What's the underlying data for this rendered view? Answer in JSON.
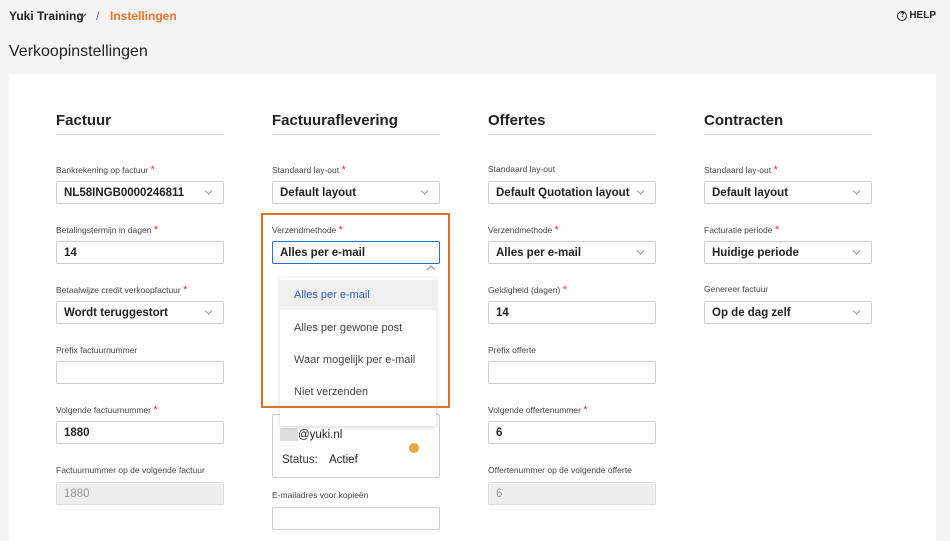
{
  "breadcrumb": {
    "app": "Yuki Training",
    "separator": "/",
    "current": "Instellingen"
  },
  "help_label": "HELP",
  "page_title": "Verkoopinstellingen",
  "required_mark": "*",
  "colors": {
    "accent": "#e8742a",
    "required": "#e53030",
    "status_dot": "#e8a640",
    "selected_text": "#2a5db0"
  },
  "factuur": {
    "title": "Factuur",
    "bankrekening": {
      "label": "Bankrekening op factuur",
      "value": "NL58INGB0000246811"
    },
    "betalingstermijn": {
      "label": "Betalingstermijn in dagen",
      "value": "14"
    },
    "betaalwijze": {
      "label": "Betaalwijze credit verkoopfactuur",
      "value": "Wordt teruggestort"
    },
    "prefix": {
      "label": "Prefix factuurnummer",
      "value": ""
    },
    "volgende": {
      "label": "Volgende factuurnummer",
      "value": "1880"
    },
    "opvolgende": {
      "label": "Factuurnummer op de volgende factuur",
      "value": "1880"
    }
  },
  "factuuraflevering": {
    "title": "Factuuraflevering",
    "layout": {
      "label": "Standaard lay-out",
      "value": "Default layout"
    },
    "verzendmethode": {
      "label": "Verzendmethode",
      "value": "Alles per e-mail"
    },
    "options": [
      "Alles per e-mail",
      "Alles per gewone post",
      "Waar mogelijk per e-mail",
      "Niet verzenden"
    ],
    "email_box": {
      "address": "@yuki.nl",
      "status_label": "Status:",
      "status": "Actief"
    },
    "kopie": {
      "label": "E-mailadres voor kopieën",
      "value": ""
    }
  },
  "offertes": {
    "title": "Offertes",
    "layout": {
      "label": "Standaard lay-out",
      "value": "Default Quotation layout"
    },
    "verzendmethode": {
      "label": "Verzendmethode",
      "value": "Alles per e-mail"
    },
    "geldigheid": {
      "label": "Geldigheid (dagen)",
      "value": "14"
    },
    "prefix": {
      "label": "Prefix offerte",
      "value": ""
    },
    "volgende": {
      "label": "Volgende offertenummer",
      "value": "6"
    },
    "opvolgende": {
      "label": "Offertenummer op de volgende offerte",
      "value": "6"
    }
  },
  "contracten": {
    "title": "Contracten",
    "layout": {
      "label": "Standaard lay-out",
      "value": "Default layout"
    },
    "periode": {
      "label": "Facturatie periode",
      "value": "Huidige periode"
    },
    "genereer": {
      "label": "Genereer factuur",
      "value": "Op de dag zelf"
    }
  }
}
